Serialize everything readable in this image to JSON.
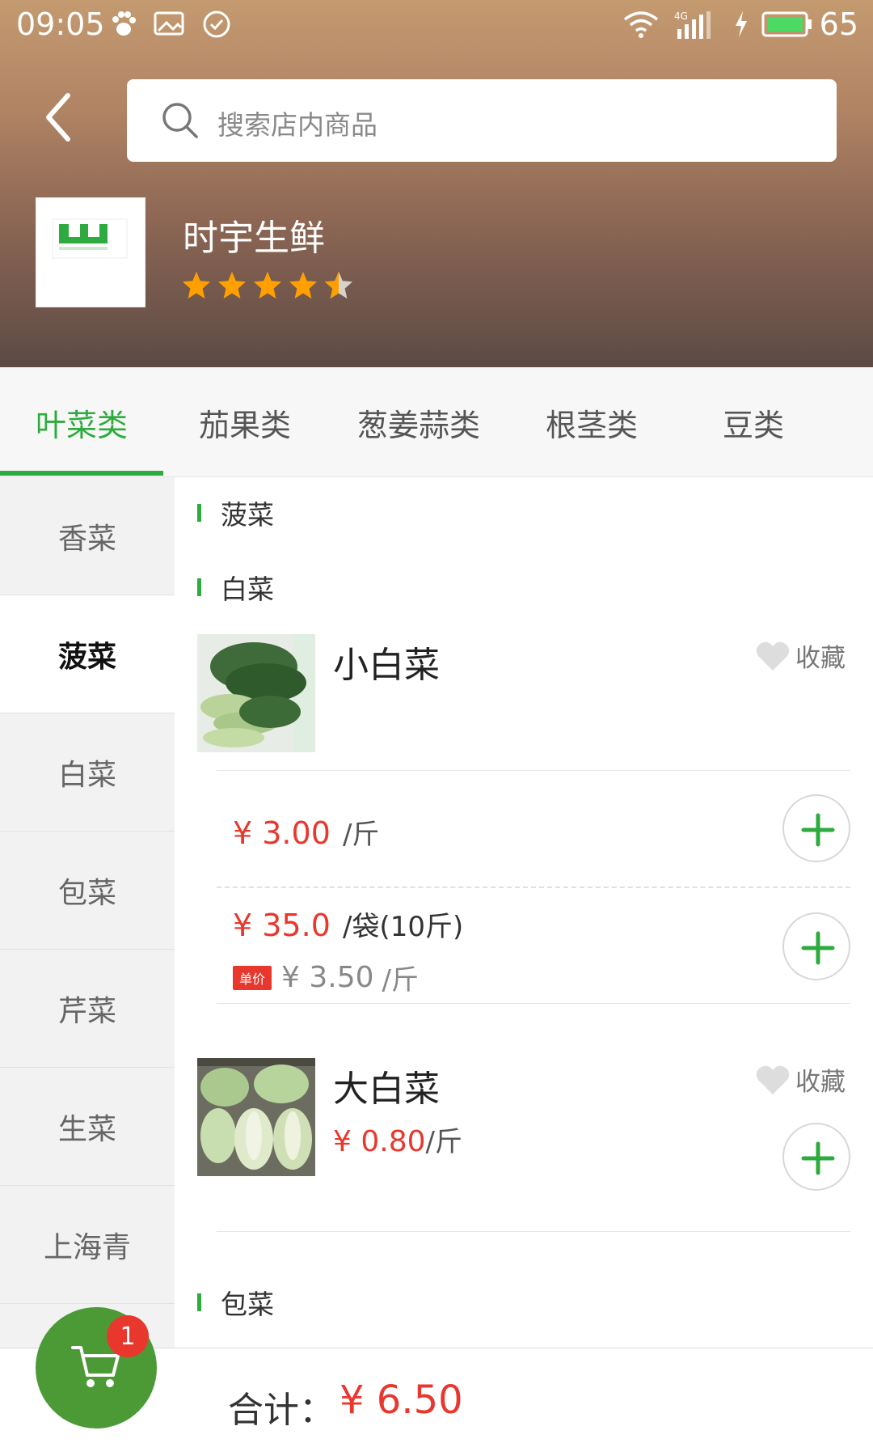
{
  "status_bar": {
    "time": "09:05",
    "network": "4G",
    "battery": "65"
  },
  "search": {
    "placeholder": "搜索店内商品"
  },
  "store": {
    "name": "时宇生鲜",
    "rating": 4.5,
    "rating_max": 5
  },
  "tabs": [
    {
      "label": "叶菜类",
      "active": true
    },
    {
      "label": "茄果类",
      "active": false
    },
    {
      "label": "葱姜蒜类",
      "active": false
    },
    {
      "label": "根茎类",
      "active": false
    },
    {
      "label": "豆类",
      "active": false
    }
  ],
  "sidebar": {
    "items": [
      {
        "label": "香菜",
        "active": false
      },
      {
        "label": "菠菜",
        "active": true
      },
      {
        "label": "白菜",
        "active": false
      },
      {
        "label": "包菜",
        "active": false
      },
      {
        "label": "芹菜",
        "active": false
      },
      {
        "label": "生菜",
        "active": false
      },
      {
        "label": "上海青",
        "active": false
      }
    ]
  },
  "content": {
    "sections": [
      {
        "title": "菠菜"
      },
      {
        "title": "白菜"
      },
      {
        "title": "包菜"
      }
    ],
    "products": [
      {
        "name": "小白菜",
        "fav_label": "收藏",
        "option1": {
          "price": "¥ 3.00",
          "unit": "/斤"
        },
        "option2": {
          "price": "¥ 35.0",
          "unit": "/袋(10斤)",
          "tag": "单价",
          "unit_price": "¥ 3.50",
          "unit_price_unit": "/斤"
        }
      },
      {
        "name": "大白菜",
        "fav_label": "收藏",
        "price": "¥ 0.80",
        "unit": "/斤"
      }
    ]
  },
  "bottom": {
    "total_label": "合计：",
    "total_value": "¥ 6.50",
    "cart_count": "1"
  },
  "colors": {
    "accent": "#2eab3e",
    "price": "#e8382e",
    "cart": "#4b9a36"
  }
}
